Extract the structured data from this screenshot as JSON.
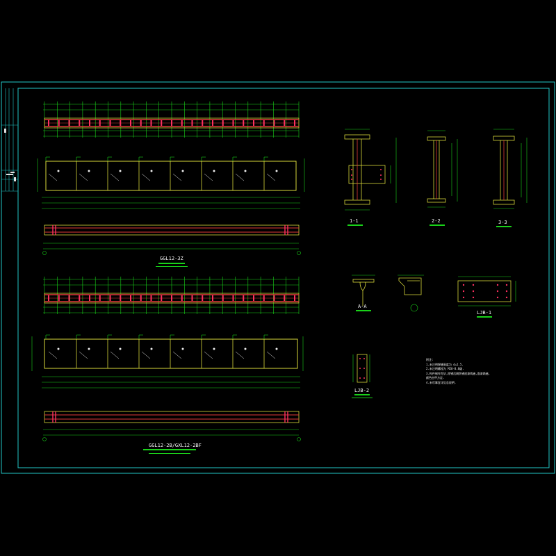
{
  "drawing": {
    "colors": {
      "background": "#000000",
      "frame": "#22c7c7",
      "member_outline": "#d8d83a",
      "dimension": "#19d219",
      "chord": "#e23a3a",
      "bolt": "#ff3060",
      "text": "#f0f0f0"
    },
    "elevations": [
      {
        "id": "upper",
        "title": "GGL12-3Z"
      },
      {
        "id": "lower",
        "title": "GGL12-2B/GXL12-2BF"
      }
    ],
    "sections": [
      {
        "id": "s11",
        "label": "1-1"
      },
      {
        "id": "s22",
        "label": "2-2"
      },
      {
        "id": "s33",
        "label": "3-3"
      }
    ],
    "details": [
      {
        "id": "dA",
        "label": "A-A"
      },
      {
        "id": "dLJB1",
        "label": "LJB-1"
      },
      {
        "id": "dLJB2",
        "label": "LJB-2"
      }
    ],
    "notes": {
      "heading": "附注:",
      "lines": [
        "1.未注明焊缝高度为 d=2.5.",
        "2.未注明螺栓为 M20-8.8级.",
        "3.构件制作完毕,除锈后刷防锈底漆两遍,面漆两遍,",
        "  颜色由甲方定.",
        "4.未尽事宜详见总说明."
      ]
    }
  }
}
